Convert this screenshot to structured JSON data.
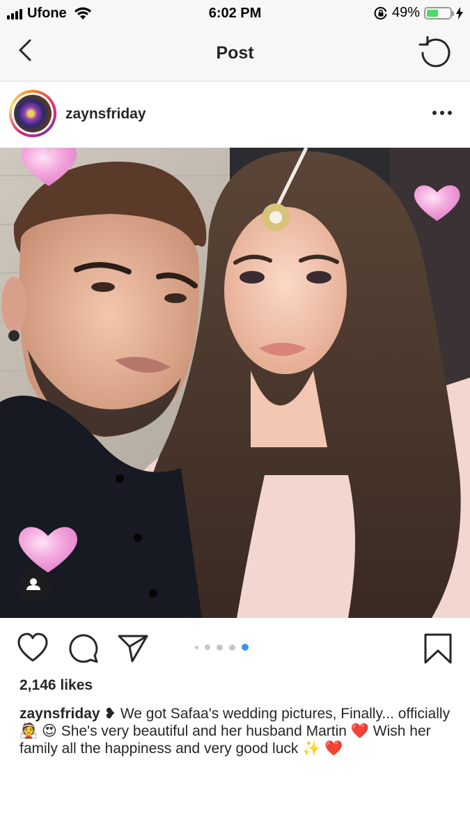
{
  "status_bar": {
    "carrier": "Ufone",
    "time": "6:02 PM",
    "battery_percent": "49%",
    "battery_level": 0.49,
    "icons": [
      "signal-icon",
      "wifi-icon",
      "rotation-lock-icon",
      "battery-icon",
      "charging-bolt-icon"
    ]
  },
  "nav": {
    "title": "Post",
    "back_icon": "chevron-left-icon",
    "refresh_icon": "refresh-icon"
  },
  "post": {
    "username": "zaynsfriday",
    "menu_icon": "more-horizontal-icon",
    "likes": "2,146 likes",
    "carousel": {
      "total": 5,
      "active": 5
    },
    "caption": {
      "username": "zaynsfriday",
      "text": " ❥ We got Safaa's wedding pictures, Finally... officially👰 😍 She's very beautiful and her husband Martin ❤️ Wish her family all the happiness and very good luck ✨ ❤️"
    }
  },
  "colors": {
    "accent_blue": "#3897f0",
    "heart_pink": "#f29bd8",
    "text": "#262626"
  }
}
